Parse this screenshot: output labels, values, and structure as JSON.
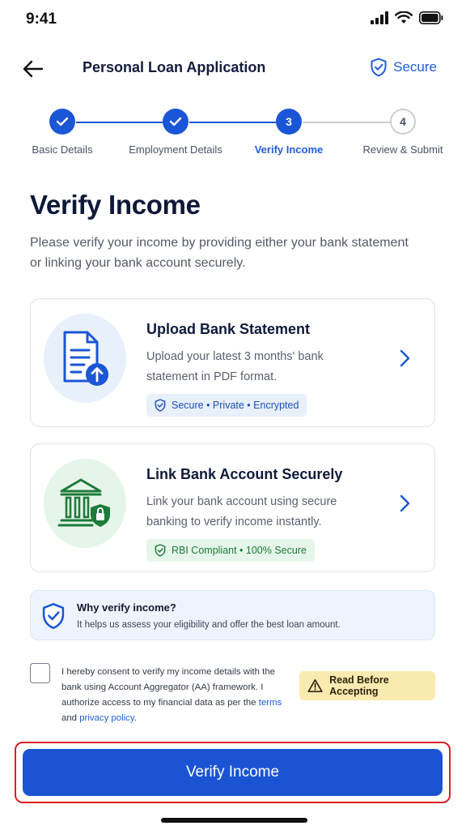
{
  "status_bar": {
    "time": "9:41"
  },
  "header": {
    "title": "Personal Loan Application",
    "secure_label": "Secure"
  },
  "stepper": {
    "steps": [
      {
        "label": "Basic Details",
        "number": "1",
        "state": "done"
      },
      {
        "label": "Employment Details",
        "number": "2",
        "state": "done"
      },
      {
        "label": "Verify Income",
        "number": "3",
        "state": "active"
      },
      {
        "label": "Review & Submit",
        "number": "4",
        "state": "pending"
      }
    ]
  },
  "main": {
    "title": "Verify Income",
    "description": "Please verify your income by providing either your bank statement or linking your bank account securely."
  },
  "options": [
    {
      "title": "Upload Bank Statement",
      "description": "Upload your latest 3 months' bank statement in PDF format.",
      "badge": "Secure • Private • Encrypted",
      "icon": "document-upload-icon",
      "accent": "#1a56d6"
    },
    {
      "title": "Link Bank Account Securely",
      "description": "Link your bank account using secure banking to verify income instantly.",
      "badge": "RBI Compliant • 100% Secure",
      "icon": "bank-lock-icon",
      "accent": "#1e7b3a"
    }
  ],
  "info": {
    "title": "Why verify income?",
    "text": "It helps us assess your eligibility and offer the best loan amount."
  },
  "consent": {
    "text": "I hereby consent to verify my income details with the bank using Account Aggregator (AA) framework. I authorize access to my financial data as per the",
    "terms_label": "terms",
    "and_label": "and",
    "privacy_label": "privacy policy",
    "end": "."
  },
  "read_before": {
    "label": "Read Before Accepting"
  },
  "cta": {
    "label": "Verify Income"
  },
  "colors": {
    "primary": "#1b54d3",
    "success": "#1e7b3a",
    "warning_bg": "#fbeab0",
    "highlight_border": "#d91f2a"
  }
}
